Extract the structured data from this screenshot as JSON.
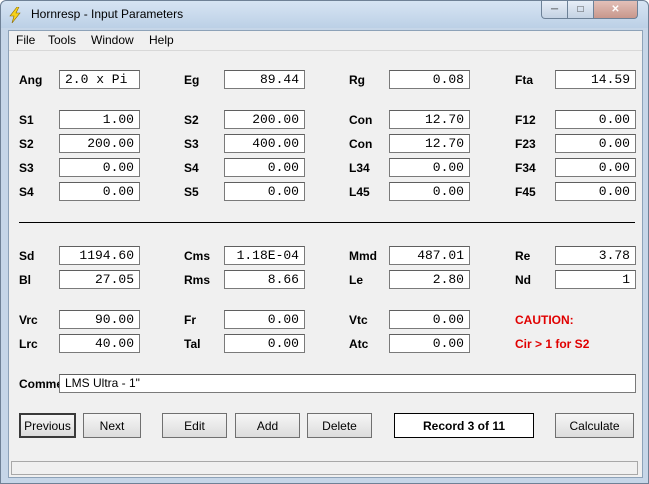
{
  "window": {
    "title": "Hornresp - Input Parameters"
  },
  "menu": [
    "File",
    "Tools",
    "Window",
    "Help"
  ],
  "row_ang": [
    {
      "label": "Ang",
      "value": "2.0 x Pi"
    },
    {
      "label": "Eg",
      "value": "89.44"
    },
    {
      "label": "Rg",
      "value": "0.08"
    },
    {
      "label": "Fta",
      "value": "14.59"
    }
  ],
  "row_s1": [
    {
      "label": "S1",
      "value": "1.00"
    },
    {
      "label": "S2",
      "value": "200.00"
    },
    {
      "label": "Con",
      "value": "12.70"
    },
    {
      "label": "F12",
      "value": "0.00"
    }
  ],
  "row_s2": [
    {
      "label": "S2",
      "value": "200.00"
    },
    {
      "label": "S3",
      "value": "400.00"
    },
    {
      "label": "Con",
      "value": "12.70"
    },
    {
      "label": "F23",
      "value": "0.00"
    }
  ],
  "row_s3": [
    {
      "label": "S3",
      "value": "0.00"
    },
    {
      "label": "S4",
      "value": "0.00"
    },
    {
      "label": "L34",
      "value": "0.00"
    },
    {
      "label": "F34",
      "value": "0.00"
    }
  ],
  "row_s4": [
    {
      "label": "S4",
      "value": "0.00"
    },
    {
      "label": "S5",
      "value": "0.00"
    },
    {
      "label": "L45",
      "value": "0.00"
    },
    {
      "label": "F45",
      "value": "0.00"
    }
  ],
  "row_sd": [
    {
      "label": "Sd",
      "value": "1194.60"
    },
    {
      "label": "Cms",
      "value": "1.18E-04"
    },
    {
      "label": "Mmd",
      "value": "487.01"
    },
    {
      "label": "Re",
      "value": "3.78"
    }
  ],
  "row_bl": [
    {
      "label": "Bl",
      "value": "27.05"
    },
    {
      "label": "Rms",
      "value": "8.66"
    },
    {
      "label": "Le",
      "value": "2.80"
    },
    {
      "label": "Nd",
      "value": "1"
    }
  ],
  "row_vrc": [
    {
      "label": "Vrc",
      "value": "90.00"
    },
    {
      "label": "Fr",
      "value": "0.00"
    },
    {
      "label": "Vtc",
      "value": "0.00"
    }
  ],
  "row_lrc": [
    {
      "label": "Lrc",
      "value": "40.00"
    },
    {
      "label": "Tal",
      "value": "0.00"
    },
    {
      "label": "Atc",
      "value": "0.00"
    }
  ],
  "caution": {
    "title": "CAUTION:",
    "message": "Cir > 1 for S2"
  },
  "comment": {
    "label": "Comment",
    "value": "LMS Ultra - 1\""
  },
  "buttons": {
    "previous": "Previous",
    "next": "Next",
    "edit": "Edit",
    "add": "Add",
    "delete": "Delete",
    "record": "Record 3 of 11",
    "calculate": "Calculate"
  },
  "colors": {
    "caution": "#e00000",
    "titlebar": "#c6d6e8"
  }
}
